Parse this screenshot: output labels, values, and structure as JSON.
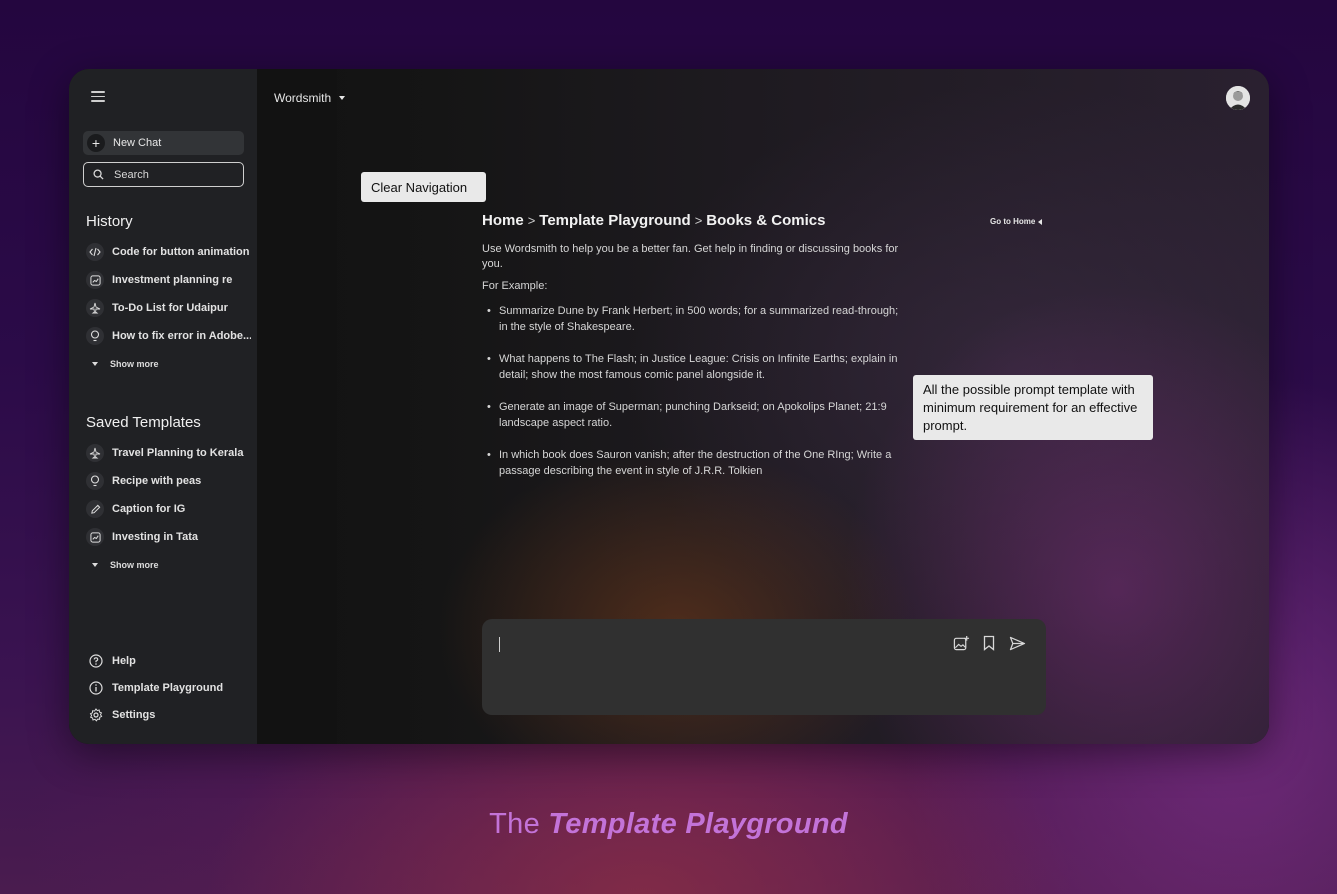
{
  "sidebar": {
    "new_chat_label": "New Chat",
    "search_label": "Search",
    "history_title": "History",
    "history_items": [
      {
        "label": "Code for button animation",
        "icon": "code-icon"
      },
      {
        "label": "Investment planning re",
        "icon": "chart-icon"
      },
      {
        "label": "To-Do List for Udaipur",
        "icon": "airplane-icon"
      },
      {
        "label": "How to fix error in Adobe...",
        "icon": "lightbulb-icon"
      }
    ],
    "history_show_more": "Show more",
    "saved_title": "Saved Templates",
    "saved_items": [
      {
        "label": "Travel Planning to Kerala",
        "icon": "airplane-icon"
      },
      {
        "label": "Recipe with peas",
        "icon": "lightbulb-icon"
      },
      {
        "label": "Caption for IG",
        "icon": "pencil-icon"
      },
      {
        "label": "Investing in Tata",
        "icon": "chart-icon"
      }
    ],
    "saved_show_more": "Show more",
    "bottom": {
      "help": "Help",
      "template_playground": "Template Playground",
      "settings": "Settings"
    }
  },
  "header": {
    "app_name": "Wordsmith"
  },
  "breadcrumb": {
    "home": "Home",
    "sep": ">",
    "template_playground": "Template Playground",
    "current": "Books & Comics"
  },
  "go_home": "Go to Home",
  "content": {
    "intro": "Use Wordsmith to help you be a better fan. Get help in finding or discussing books for you.",
    "examples_label": "For Example:",
    "examples": [
      "Summarize Dune by Frank Herbert; in 500 words; for a summarized read-through; in the style of Shakespeare.",
      "What happens to The Flash; in Justice League: Crisis on Infinite Earths; explain in detail; show the most famous comic panel alongside it.",
      "Generate an image of Superman; punching Darkseid; on Apokolips Planet; 21:9 landscape aspect ratio.",
      "In which book does Sauron vanish; after the destruction of the One RIng; Write a passage describing the event in style of J.R.R. Tolkien"
    ]
  },
  "composer": {
    "tools": [
      "add-image-icon",
      "bookmark-icon",
      "send-icon"
    ]
  },
  "annotations": {
    "clear_navigation": "Clear Navigation",
    "template_note": "All the possible prompt template with minimum requirement for an effective prompt."
  },
  "caption": {
    "prefix": "The ",
    "emphasis": "Template Playground"
  },
  "colors": {
    "background": "#2b0b48",
    "sidebar": "#202124",
    "accent_caption": "#c373d8",
    "callout": "#e9e9e9"
  }
}
